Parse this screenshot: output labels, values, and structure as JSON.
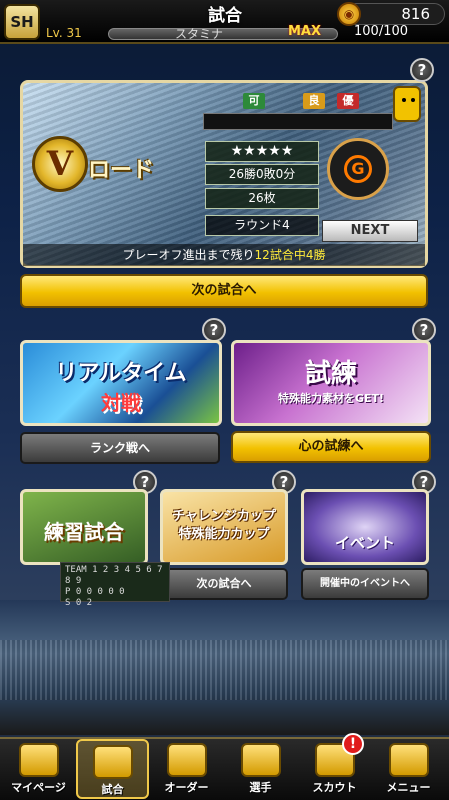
{
  "header": {
    "logo": "SH",
    "title": "試合",
    "coin_icon": "coin-icon",
    "coins": "816",
    "level": "Lv. 31",
    "stamina_label": "スタミナ",
    "stamina_max": "MAX",
    "stamina_value": "100/100"
  },
  "vroad": {
    "help": "?",
    "badge_letter": "V",
    "title": "ロード",
    "eval_labels": [
      "可",
      "良",
      "優"
    ],
    "stars": "★★★★★",
    "record": "26勝0敗0分",
    "tickets": "26枚",
    "round": "ラウンド4",
    "emblem_text": "G",
    "next_label": "NEXT",
    "progress_text": "プレーオフ進出まで残り",
    "progress_highlight": "12試合中4勝"
  },
  "next_match_button": "次の試合へ",
  "modes": {
    "realtime": {
      "line1": "リアルタイム",
      "line2": "対戦",
      "button": "ランク戦へ",
      "help": "?"
    },
    "shiren": {
      "title": "試練",
      "subtitle": "特殊能力素材をGET!",
      "button": "心の試練へ",
      "help": "?"
    },
    "practice": {
      "title": "練習試合",
      "help": "?"
    },
    "challenge": {
      "line1": "チャレンジカップ",
      "line2": "特殊能力カップ",
      "button": "次の試合へ",
      "help": "?"
    },
    "event": {
      "title": "イベント",
      "button": "開催中のイベントへ",
      "help": "?"
    }
  },
  "scoreboard": [
    "TEAM 1 2 3 4 5 6 7 8 9",
    "P  0 0 0 0 0",
    "S  0 2"
  ],
  "nav": {
    "items": [
      {
        "label": "マイページ",
        "icon": "home-icon"
      },
      {
        "label": "試合",
        "icon": "stadium-icon"
      },
      {
        "label": "オーダー",
        "icon": "field-icon"
      },
      {
        "label": "選手",
        "icon": "player-icon"
      },
      {
        "label": "スカウト",
        "icon": "scout-icon"
      },
      {
        "label": "メニュー",
        "icon": "menu-icon"
      }
    ],
    "scout_badge": "!"
  }
}
